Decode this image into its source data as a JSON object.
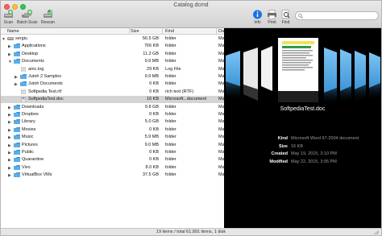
{
  "window": {
    "title": "Catalog.dcmd"
  },
  "toolbar": {
    "scan_label": "Scan",
    "batch_scan_label": "Batch Scan",
    "rescan_label": "Rescan",
    "info_label": "Info",
    "print_label": "Print",
    "find_label": "Find"
  },
  "search": {
    "value": ""
  },
  "columns": {
    "name": "Name",
    "size": "Size",
    "kind": "Kind",
    "date": "Da"
  },
  "rows": [
    {
      "name": "sergiu",
      "size": "56.5 GB",
      "kind": "folder",
      "date": "Ma",
      "depth": 0,
      "expanded": true,
      "icon": "drive-icon",
      "selected": false
    },
    {
      "name": "Applications",
      "size": "766 KB",
      "kind": "folder",
      "date": "Ma",
      "depth": 1,
      "expanded": false,
      "icon": "folder-icon",
      "selected": false
    },
    {
      "name": "Desktop",
      "size": "11.2 GB",
      "kind": "folder",
      "date": "Ma",
      "depth": 1,
      "expanded": false,
      "icon": "folder-icon",
      "selected": false
    },
    {
      "name": "Documents",
      "size": "9.9 MB",
      "kind": "folder",
      "date": "Ma",
      "depth": 1,
      "expanded": true,
      "icon": "folder-icon",
      "selected": false
    },
    {
      "name": "amc.log",
      "size": "29 KB",
      "kind": "Log File",
      "date": "Ma",
      "depth": 2,
      "expanded": null,
      "icon": "document-icon",
      "selected": false
    },
    {
      "name": "Jutoh 2 Samples",
      "size": "9.9 MB",
      "kind": "folder",
      "date": "Ma",
      "depth": 2,
      "expanded": false,
      "icon": "folder-icon",
      "selected": false
    },
    {
      "name": "Jutoh Documents",
      "size": "0 KB",
      "kind": "folder",
      "date": "Ma",
      "depth": 2,
      "expanded": false,
      "icon": "folder-icon",
      "selected": false
    },
    {
      "name": "Softpedia Test.rtf",
      "size": "0 KB",
      "kind": "rich text (RTF)",
      "date": "Ma",
      "depth": 2,
      "expanded": null,
      "icon": "document-icon",
      "selected": false
    },
    {
      "name": "SoftpediaTest.doc",
      "size": "16 KB",
      "kind": "Microsoft...document",
      "date": "Ma",
      "depth": 2,
      "expanded": null,
      "icon": "word-document-icon",
      "selected": true
    },
    {
      "name": "Downloads",
      "size": "9.8 GB",
      "kind": "folder",
      "date": "Ma",
      "depth": 1,
      "expanded": false,
      "icon": "folder-icon",
      "selected": false
    },
    {
      "name": "Dropbox",
      "size": "0 KB",
      "kind": "folder",
      "date": "Ma",
      "depth": 1,
      "expanded": false,
      "icon": "folder-icon",
      "selected": false
    },
    {
      "name": "Library",
      "size": "5.0 GB",
      "kind": "folder",
      "date": "Ma",
      "depth": 1,
      "expanded": false,
      "icon": "folder-icon",
      "selected": false
    },
    {
      "name": "Movies",
      "size": "0 KB",
      "kind": "folder",
      "date": "Ma",
      "depth": 1,
      "expanded": false,
      "icon": "folder-icon",
      "selected": false
    },
    {
      "name": "Music",
      "size": "5.9 MB",
      "kind": "folder",
      "date": "Ma",
      "depth": 1,
      "expanded": false,
      "icon": "folder-icon",
      "selected": false
    },
    {
      "name": "Pictures",
      "size": "9.0 MB",
      "kind": "folder",
      "date": "Ma",
      "depth": 1,
      "expanded": false,
      "icon": "folder-icon",
      "selected": false
    },
    {
      "name": "Public",
      "size": "0 KB",
      "kind": "folder",
      "date": "Ma",
      "depth": 1,
      "expanded": false,
      "icon": "folder-icon",
      "selected": false
    },
    {
      "name": "Quarantine",
      "size": "0 KB",
      "kind": "folder",
      "date": "Ma",
      "depth": 1,
      "expanded": false,
      "icon": "folder-icon",
      "selected": false
    },
    {
      "name": "Vivo",
      "size": "8.0 KB",
      "kind": "folder",
      "date": "Ma",
      "depth": 1,
      "expanded": false,
      "icon": "folder-icon",
      "selected": false
    },
    {
      "name": "VirtualBox VMs",
      "size": "37.5 GB",
      "kind": "folder",
      "date": "Ma",
      "depth": 1,
      "expanded": false,
      "icon": "folder-icon",
      "selected": false
    }
  ],
  "preview": {
    "file_name": "SoftpediaTest.doc",
    "info": [
      {
        "key": "Kind",
        "value": "Microsoft Word 97-2004 document"
      },
      {
        "key": "Size",
        "value": "16 KB"
      },
      {
        "key": "Created",
        "value": "May 19, 2015, 3:10 PM"
      },
      {
        "key": "Modified",
        "value": "May 22, 2015, 3:05 PM"
      }
    ]
  },
  "status": {
    "text": "19 items / total 61,891 items, 1 disk"
  },
  "colors": {
    "folder": "#5aaee9",
    "folder_dark": "#3c8fd0",
    "selection": "#d4d4d4",
    "info_accent": "#1a73e8"
  }
}
